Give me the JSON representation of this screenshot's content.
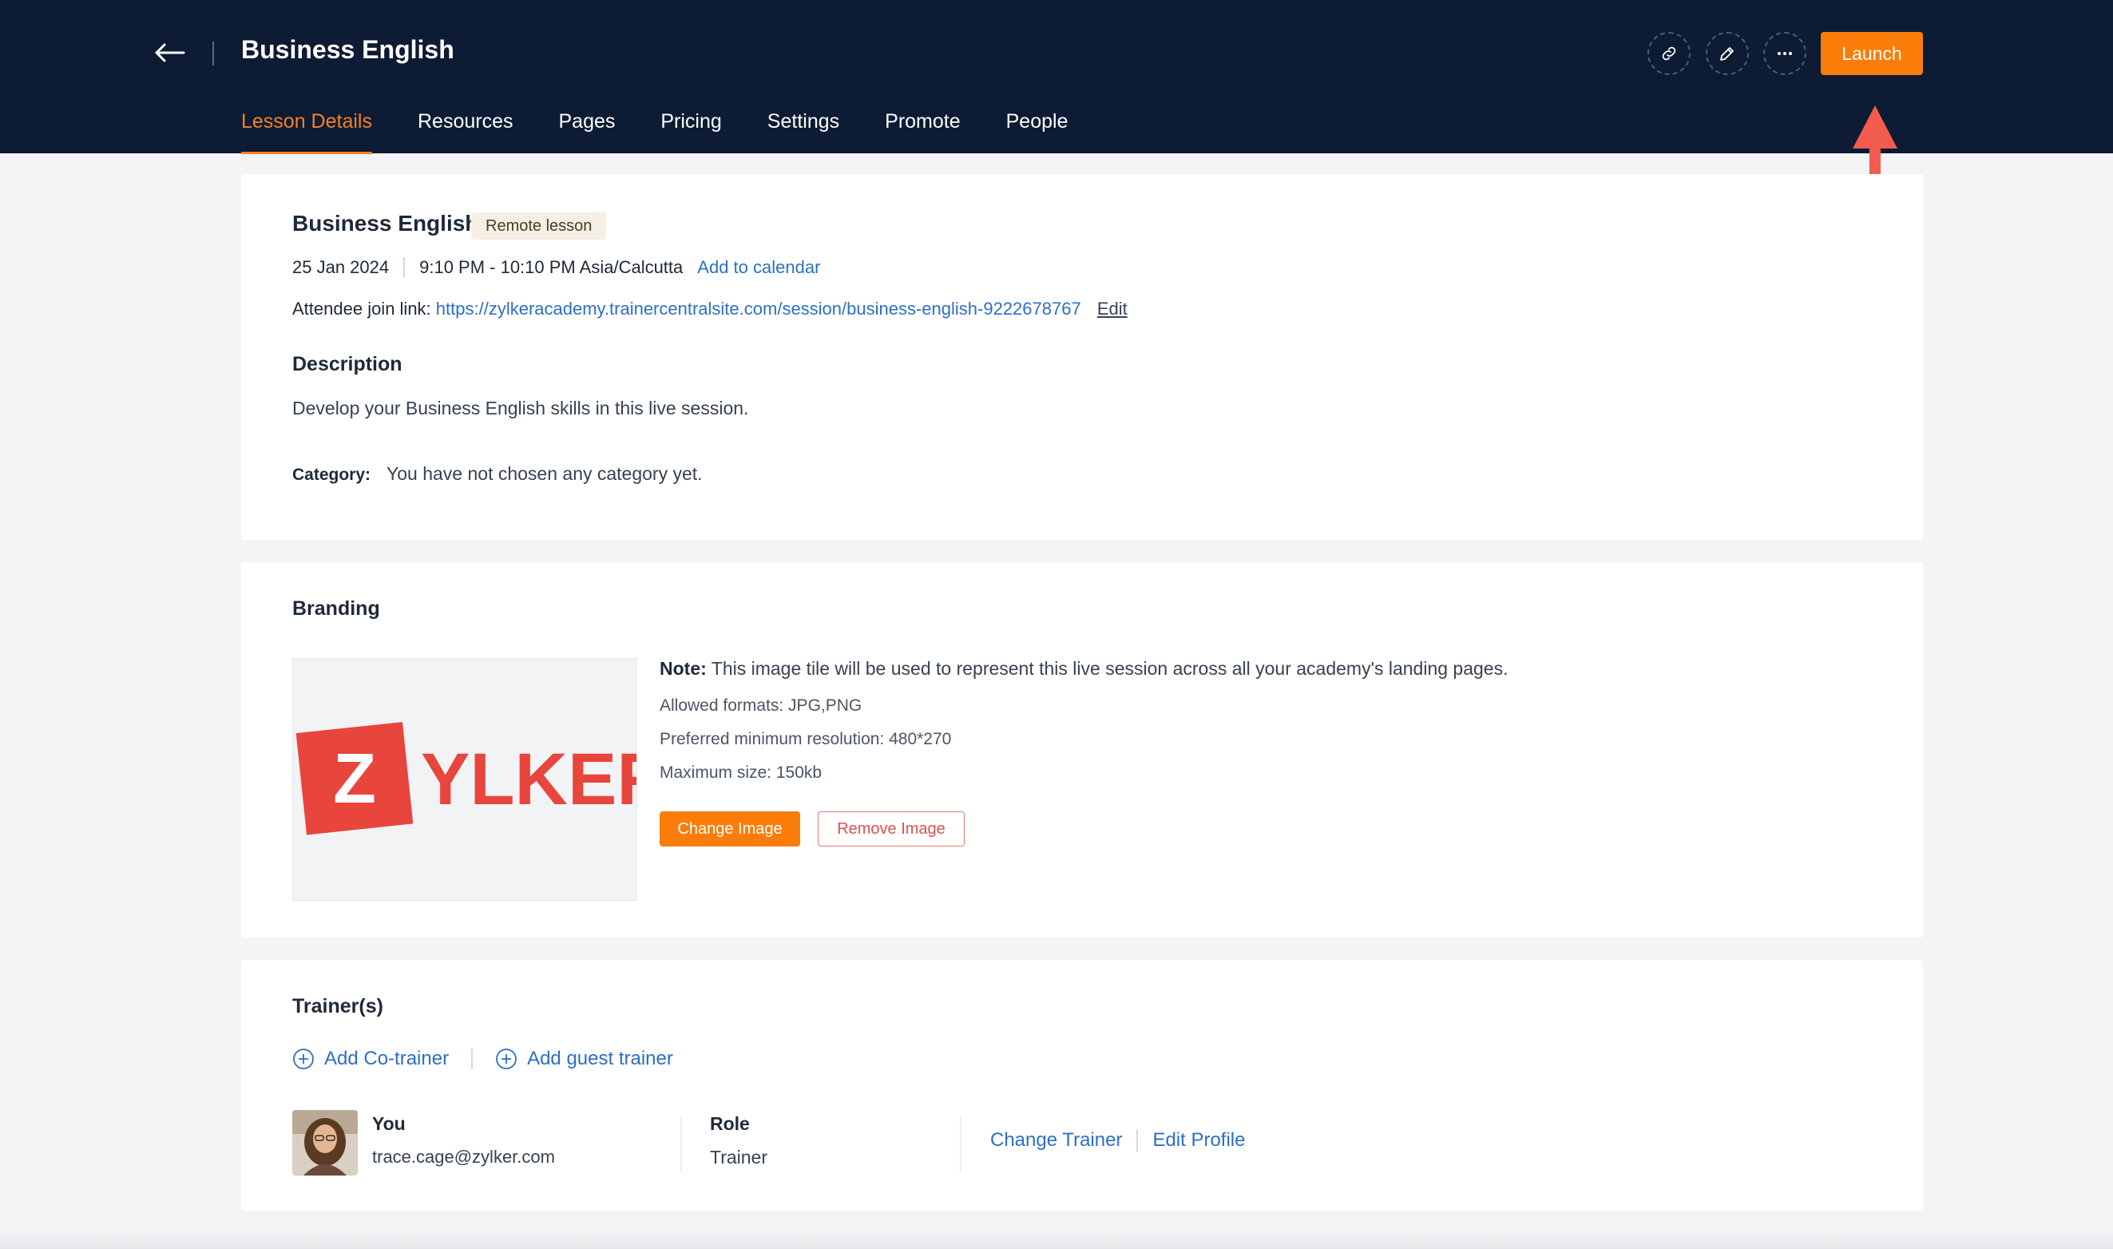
{
  "header": {
    "title": "Business English",
    "launch_label": "Launch",
    "tabs": [
      {
        "label": "Lesson Details",
        "active": true
      },
      {
        "label": "Resources"
      },
      {
        "label": "Pages"
      },
      {
        "label": "Pricing"
      },
      {
        "label": "Settings"
      },
      {
        "label": "Promote"
      },
      {
        "label": "People"
      }
    ],
    "icons": [
      "back-arrow-icon",
      "link-icon",
      "pencil-icon",
      "more-icon"
    ]
  },
  "lesson": {
    "title": "Business English",
    "badge": "Remote lesson",
    "date": "25 Jan 2024",
    "time": "9:10 PM - 10:10 PM Asia/Calcutta",
    "add_calendar": "Add to calendar",
    "join_label": "Attendee join link:",
    "join_url": "https://zylkeracademy.trainercentralsite.com/session/business-english-9222678767",
    "edit_label": "Edit",
    "description_heading": "Description",
    "description": "Develop your Business English skills in this live session.",
    "category_label": "Category:",
    "category_value": "You have not chosen any category yet."
  },
  "branding": {
    "heading": "Branding",
    "logo_text": "ZYLKER",
    "note_label": "Note:",
    "note_text": "This image tile will be used to represent this live session across all your academy's landing pages.",
    "formats": "Allowed formats: JPG,PNG",
    "resolution": "Preferred minimum resolution: 480*270",
    "max_size": "Maximum size: 150kb",
    "change_label": "Change Image",
    "remove_label": "Remove Image"
  },
  "trainers": {
    "heading": "Trainer(s)",
    "add_cotrainer": "Add Co-trainer",
    "add_guest": "Add guest trainer",
    "name": "You",
    "email": "trace.cage@zylker.com",
    "role_heading": "Role",
    "role_value": "Trainer",
    "change_trainer": "Change Trainer",
    "edit_profile": "Edit Profile"
  },
  "colors": {
    "header_bg": "#0d1b34",
    "accent": "#fa7d09",
    "link": "#2d6fc4",
    "annotation_arrow": "#f25c4f"
  }
}
